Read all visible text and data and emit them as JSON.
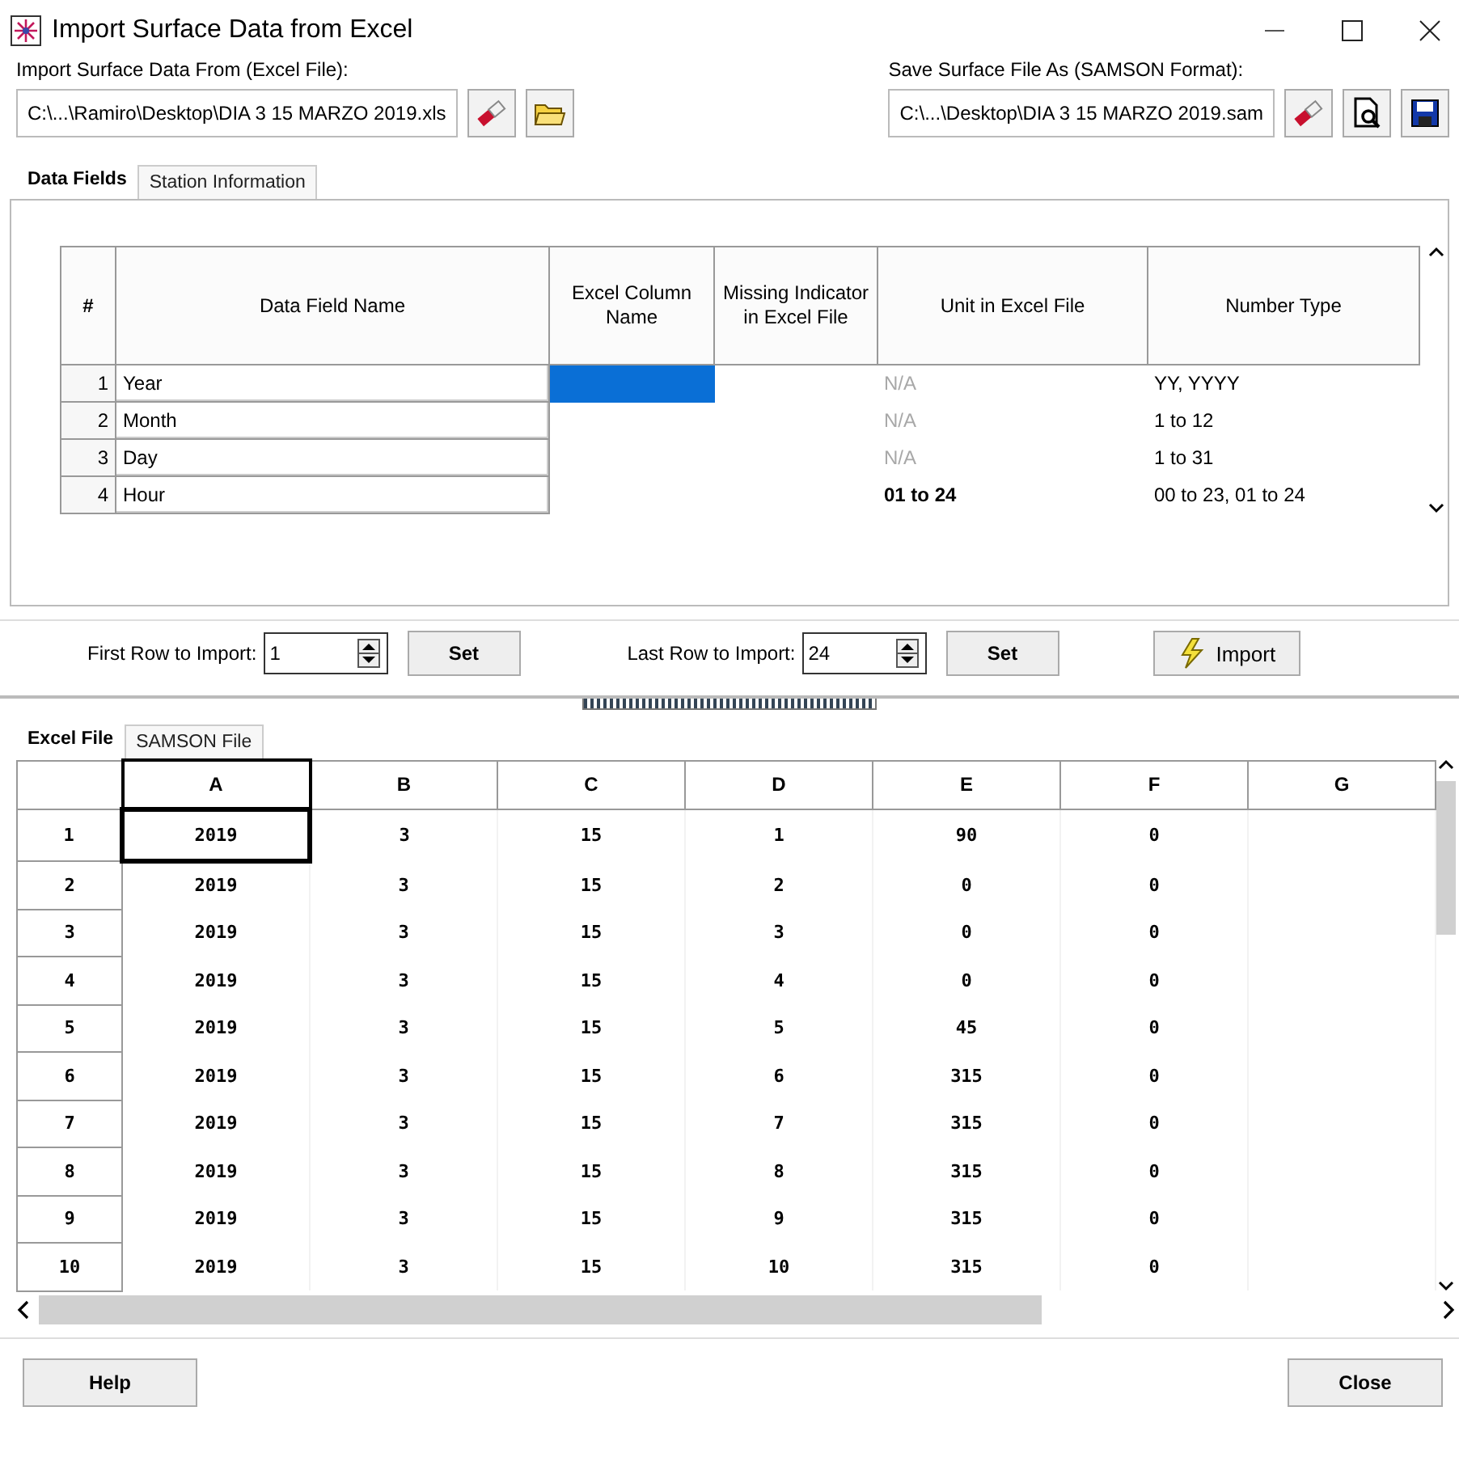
{
  "window": {
    "title": "Import Surface Data from Excel"
  },
  "import_file": {
    "label": "Import Surface Data From (Excel File):",
    "value": "C:\\...\\Ramiro\\Desktop\\DIA 3 15 MARZO 2019.xls"
  },
  "save_file": {
    "label": "Save Surface File As (SAMSON Format):",
    "value": "C:\\...\\Desktop\\DIA 3 15 MARZO 2019.sam"
  },
  "top_tabs": [
    {
      "label": "Data Fields",
      "selected": true
    },
    {
      "label": "Station Information",
      "selected": false
    }
  ],
  "fields_table": {
    "columns": [
      "#",
      "Data Field Name",
      "Excel Column Name",
      "Missing Indicator in Excel File",
      "Unit in Excel File",
      "Number Type"
    ],
    "rows": [
      {
        "number": "1",
        "name": "Year",
        "column_selected": true,
        "unit": "N/A",
        "unit_enabled": false,
        "number_type": "YY, YYYY"
      },
      {
        "number": "2",
        "name": "Month",
        "column_selected": false,
        "unit": "N/A",
        "unit_enabled": false,
        "number_type": "1 to 12"
      },
      {
        "number": "3",
        "name": "Day",
        "column_selected": false,
        "unit": "N/A",
        "unit_enabled": false,
        "number_type": "1 to 31"
      },
      {
        "number": "4",
        "name": "Hour",
        "column_selected": false,
        "unit": "01 to 24",
        "unit_enabled": true,
        "number_type": "00 to 23, 01 to 24"
      }
    ]
  },
  "first_row": {
    "label": "First Row to Import:",
    "value": "1",
    "button": "Set"
  },
  "last_row": {
    "label": "Last Row to Import:",
    "value": "24",
    "button": "Set"
  },
  "import_button": "Import",
  "bottom_tabs": [
    {
      "label": "Excel File",
      "selected": true
    },
    {
      "label": "SAMSON File",
      "selected": false
    }
  ],
  "grid": {
    "columns": [
      "A",
      "B",
      "C",
      "D",
      "E",
      "F",
      "G"
    ],
    "rows": [
      {
        "header": "1",
        "active": true,
        "cells": [
          "2019",
          "3",
          "15",
          "1",
          "90",
          "0"
        ]
      },
      {
        "header": "2",
        "active": false,
        "cells": [
          "2019",
          "3",
          "15",
          "2",
          "0",
          "0"
        ]
      },
      {
        "header": "3",
        "active": false,
        "cells": [
          "2019",
          "3",
          "15",
          "3",
          "0",
          "0"
        ]
      },
      {
        "header": "4",
        "active": false,
        "cells": [
          "2019",
          "3",
          "15",
          "4",
          "0",
          "0"
        ]
      },
      {
        "header": "5",
        "active": false,
        "cells": [
          "2019",
          "3",
          "15",
          "5",
          "45",
          "0"
        ]
      },
      {
        "header": "6",
        "active": false,
        "cells": [
          "2019",
          "3",
          "15",
          "6",
          "315",
          "0"
        ]
      },
      {
        "header": "7",
        "active": false,
        "cells": [
          "2019",
          "3",
          "15",
          "7",
          "315",
          "0"
        ]
      },
      {
        "header": "8",
        "active": false,
        "cells": [
          "2019",
          "3",
          "15",
          "8",
          "315",
          "0"
        ]
      },
      {
        "header": "9",
        "active": false,
        "cells": [
          "2019",
          "3",
          "15",
          "9",
          "315",
          "0"
        ]
      },
      {
        "header": "10",
        "active": false,
        "cells": [
          "2019",
          "3",
          "15",
          "10",
          "315",
          "0"
        ]
      }
    ]
  },
  "footer": {
    "help": "Help",
    "close": "Close"
  }
}
